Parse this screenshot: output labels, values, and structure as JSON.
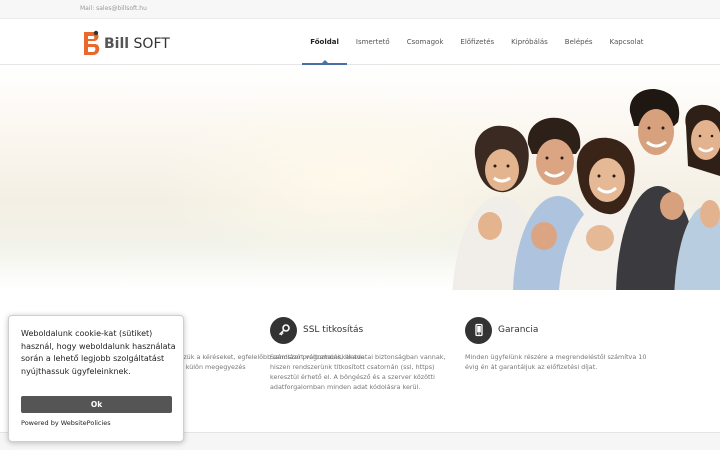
{
  "topbar": {
    "mail": "Mail: sales@billsoft.hu"
  },
  "logo": {
    "bill": "Bill",
    "soft": "SOFT"
  },
  "nav": {
    "items": [
      {
        "label": "Főoldal"
      },
      {
        "label": "Ismertető"
      },
      {
        "label": "Csomagok"
      },
      {
        "label": "Előfizetés"
      },
      {
        "label": "Kipróbálás"
      },
      {
        "label": "Belépés"
      },
      {
        "label": "Kapcsolat"
      }
    ]
  },
  "features": [
    {
      "title": "",
      "text": "szük a kéréseket, egfelelőbb rendszert változtatás, illetve k külön megegyezés",
      "icon": ""
    },
    {
      "title": "SSL titkosítás",
      "text": "Számlázó programunkkal adatai biztonságban vannak, hiszen rendszerünk titkosított csatornán (ssl, https) keresztül érhető el. A böngésző és a szerver közötti adatforgalomban minden adat kódolásra kerül.",
      "icon": "key-icon"
    },
    {
      "title": "Garancia",
      "text": "Minden ügyfelünk részére a megrendeléstől számítva 10 évig én át garantáljuk az előfizetési díjat.",
      "icon": "phone-icon"
    }
  ],
  "cookie": {
    "text": "Weboldalunk cookie-kat (sütiket) használ, hogy weboldalunk használata során a lehető legjobb szolgáltatást nyújthassuk ügyfeleinknek.",
    "button": "Ok",
    "powered": "Powered by WebsitePolicies"
  },
  "colors": {
    "accent": "#4a6fa5",
    "logo_orange": "#e8692b",
    "icon_bg": "#333333"
  }
}
